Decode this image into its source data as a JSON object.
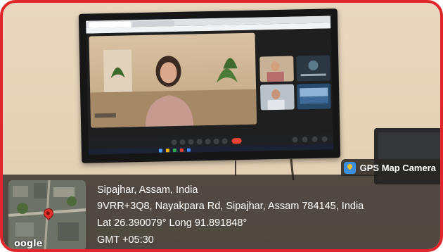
{
  "gps_brand": {
    "label": "GPS Map Camera",
    "icon": "gps-map-camera-icon"
  },
  "location": {
    "place": "Sipajhar, Assam, India",
    "address": "9VRR+3Q8, Nayakpara Rd, Sipajhar, Assam 784145, India",
    "coordinates": "Lat 26.390079° Long 91.891848°",
    "timezone": "GMT +05:30"
  },
  "map": {
    "label": "oogle",
    "pin_icon": "map-pin-icon"
  },
  "colors": {
    "frame_border": "#e0262a",
    "overlay": "#28242199",
    "pin": "#e4302c"
  }
}
